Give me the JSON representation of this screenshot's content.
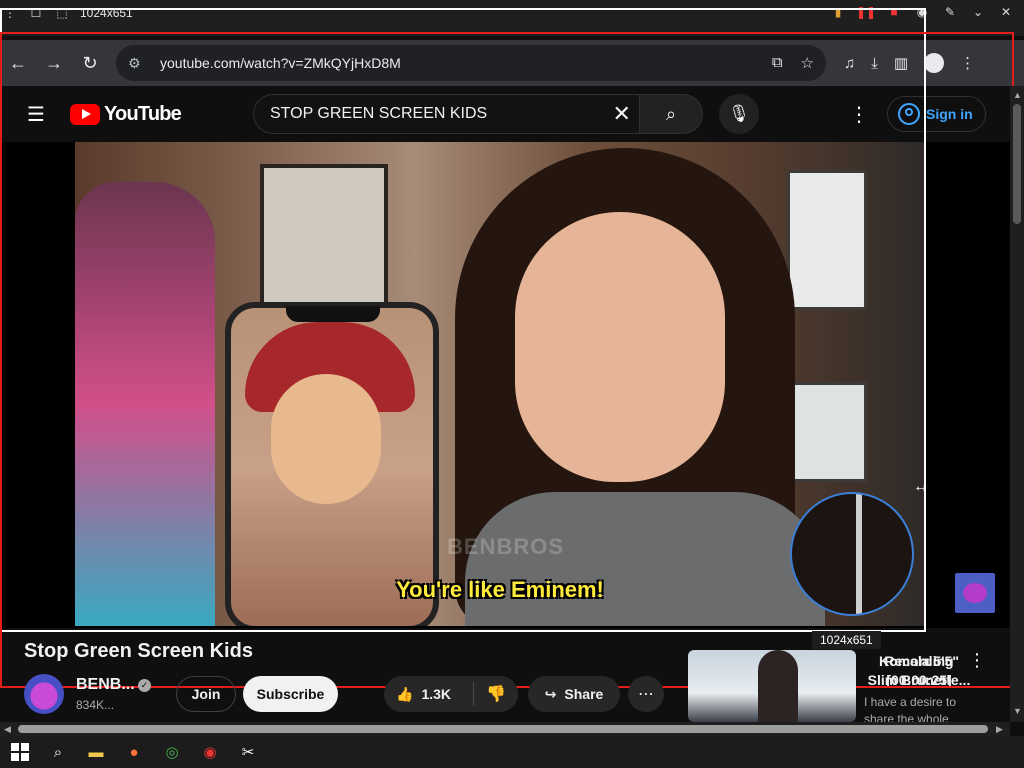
{
  "recorder": {
    "size_label": "1024x651",
    "status": "Recording [00:00:25]"
  },
  "browser": {
    "url": "youtube.com/watch?v=ZMkQYjHxD8M"
  },
  "youtube": {
    "logo_text": "YouTube",
    "search_query": "STOP GREEN SCREEN KIDS",
    "sign_in": "Sign in"
  },
  "video": {
    "subtitle": "You're like Eminem!",
    "watermark": "BENBROS",
    "title": "Stop Green Screen Kids"
  },
  "channel": {
    "name": "BENB...",
    "subscribers": "834K...",
    "join": "Join",
    "subscribe": "Subscribe"
  },
  "actions": {
    "likes": "1.3K",
    "share": "Share"
  },
  "recommended": {
    "title": "Komala 5'5\" Slim Brunette...",
    "description": "I have a desire to share the whole"
  },
  "overlay": {
    "size_label_bottom": "1024x651"
  },
  "colors": {
    "youtube_red": "#ff0000",
    "selection_red": "#e11d1d",
    "link_blue": "#3ea6ff",
    "subtitle_yellow": "#ffeb3b"
  }
}
